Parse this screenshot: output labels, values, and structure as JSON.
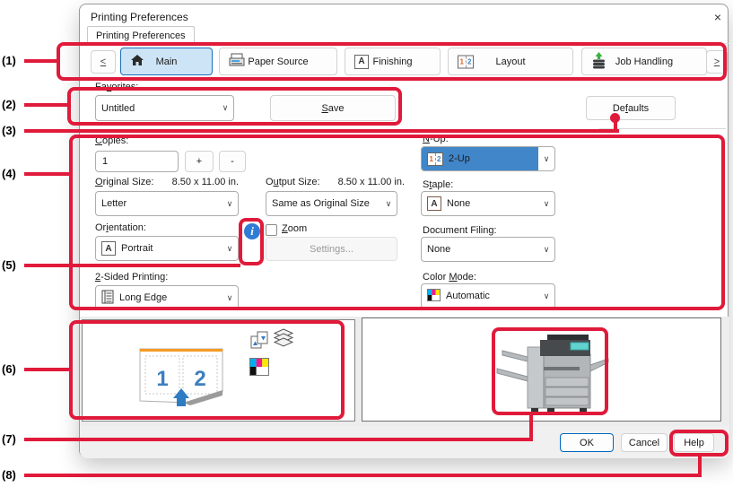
{
  "window": {
    "title": "Printing Preferences",
    "close_glyph": "×"
  },
  "sheet_tab": {
    "label": "Printing Preferences"
  },
  "tab_bar": {
    "scroll_left": "<",
    "scroll_right": ">",
    "items": [
      {
        "label": "Main",
        "selected": true
      },
      {
        "label": "Paper Source",
        "selected": false
      },
      {
        "label": "Finishing",
        "selected": false
      },
      {
        "label": "Layout",
        "selected": false
      },
      {
        "label": "Job Handling",
        "selected": false
      }
    ]
  },
  "favorites": {
    "label": "Fa_vorites:",
    "value": "Untitled",
    "save_label": "_Save",
    "defaults_label": "De_faults"
  },
  "settings": {
    "copies": {
      "label": "_Copies:",
      "value": "1",
      "plus": "+",
      "minus": "-"
    },
    "original_size": {
      "label": "_Original Size:",
      "dimension": "8.50 x 11.00 in.",
      "value": "Letter"
    },
    "output_size": {
      "label": "O_utput Size:",
      "dimension": "8.50 x 11.00 in.",
      "value": "Same as Original Size"
    },
    "orientation": {
      "label": "Or_ientation:",
      "value": "Portrait"
    },
    "zoom": {
      "label": "_Zoom",
      "checked": false,
      "settings_label": "Settings..."
    },
    "two_sided": {
      "label": "_2-Sided Printing:",
      "value": "Long Edge"
    },
    "n_up": {
      "label": "_N-Up:",
      "value": "2-Up"
    },
    "staple": {
      "label": "S_taple:",
      "value": "None"
    },
    "document_filing": {
      "label": "Document Filin_g:",
      "value": "None"
    },
    "color_mode": {
      "label": "Color _Mode:",
      "value": "Automatic"
    }
  },
  "preview": {
    "page_one": "1",
    "page_two": "2"
  },
  "footer": {
    "ok": "OK",
    "cancel": "Cancel",
    "help": "Help"
  },
  "glyphs": {
    "chevron": "∨",
    "letter_a": "A",
    "one": "1",
    "two": "2"
  },
  "annotations": {
    "color": "#e01a3a",
    "labels": [
      "(1)",
      "(2)",
      "(3)",
      "(4)",
      "(5)",
      "(6)",
      "(7)",
      "(8)"
    ]
  }
}
